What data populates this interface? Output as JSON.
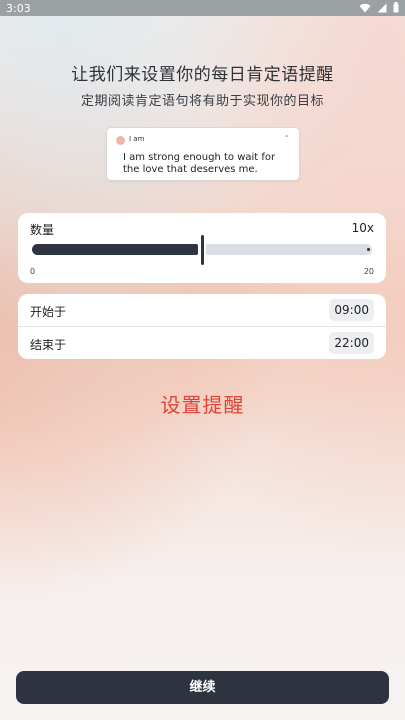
{
  "status_bar": {
    "time": "3:03",
    "icons": [
      "wifi-icon",
      "signal-icon",
      "battery-icon"
    ]
  },
  "header": {
    "title": "让我们来设置你的每日肯定语提醒",
    "subtitle": "定期阅读肯定语句将有助于实现你的目标"
  },
  "notification_preview": {
    "app_name": "I am",
    "message": "I am strong enough to wait for the love that deserves me."
  },
  "count": {
    "label": "数量",
    "value": 10,
    "value_text": "10x",
    "min": 0,
    "max": 20,
    "min_label": "0",
    "max_label": "20"
  },
  "schedule": {
    "start_label": "开始于",
    "start_time": "09:00",
    "end_label": "结束于",
    "end_time": "22:00"
  },
  "set_reminder_label": "设置提醒",
  "continue_label": "继续",
  "colors": {
    "accent_red": "#e0453a",
    "dark": "#2d3440",
    "track_inactive": "#d9dee4"
  }
}
